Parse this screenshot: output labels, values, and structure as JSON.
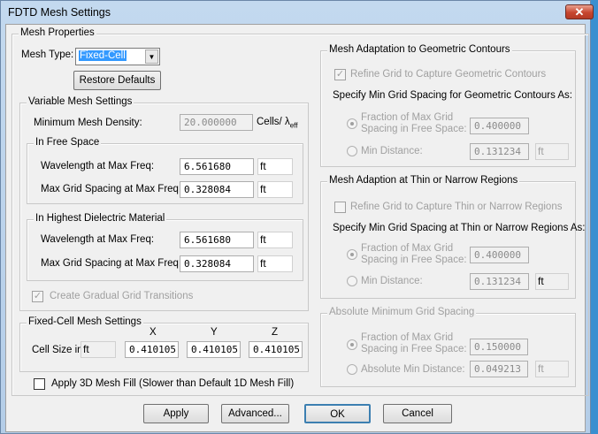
{
  "window": {
    "title": "FDTD Mesh Settings",
    "close_icon": "close-icon"
  },
  "mesh_properties": {
    "label": "Mesh Properties",
    "mesh_type_label": "Mesh Type:",
    "mesh_type_value": "Fixed-Cell",
    "restore_defaults": "Restore Defaults"
  },
  "variable_mesh": {
    "label": "Variable Mesh Settings",
    "min_density_label": "Minimum Mesh Density:",
    "min_density_value": "20.000000",
    "density_unit": "Cells/ λ",
    "density_unit_sub": "eff",
    "free_space": {
      "label": "In Free Space",
      "wavelength_label": "Wavelength at Max Freq:",
      "wavelength_value": "6.561680",
      "wavelength_unit": "ft",
      "spacing_label": "Max Grid Spacing at Max Freq:",
      "spacing_value": "0.328084",
      "spacing_unit": "ft"
    },
    "dielectric": {
      "label": "In Highest Dielectric Material",
      "wavelength_label": "Wavelength at Max Freq:",
      "wavelength_value": "6.561680",
      "wavelength_unit": "ft",
      "spacing_label": "Max Grid Spacing at Max Freq:",
      "spacing_value": "0.328084",
      "spacing_unit": "ft"
    },
    "gradual_label": "Create Gradual Grid Transitions",
    "gradual_checked": true
  },
  "fixed_cell": {
    "label": "Fixed-Cell Mesh Settings",
    "x_header": "X",
    "y_header": "Y",
    "z_header": "Z",
    "cell_size_label": "Cell Size in",
    "unit": "ft",
    "x": "0.410105",
    "y": "0.410105",
    "z": "0.410105"
  },
  "mesh_fill": {
    "label": "Apply 3D Mesh Fill (Slower than Default 1D Mesh Fill)",
    "checked": false
  },
  "geometric": {
    "label": "Mesh Adaptation to Geometric Contours",
    "refine_label": "Refine Grid to Capture Geometric Contours",
    "refine_checked": true,
    "specify_label": "Specify Min Grid Spacing for Geometric Contours As:",
    "fraction_label_1": "Fraction of Max Grid",
    "fraction_label_2": "Spacing in Free Space:",
    "fraction_value": "0.400000",
    "min_label": "Min Distance:",
    "min_value": "0.131234",
    "min_unit": "ft"
  },
  "thin": {
    "label": "Mesh Adaption at Thin or Narrow Regions",
    "refine_label": "Refine Grid to Capture Thin or Narrow Regions",
    "refine_checked": false,
    "specify_label": "Specify Min Grid Spacing at Thin or Narrow Regions As:",
    "fraction_label_1": "Fraction of Max Grid",
    "fraction_label_2": "Spacing in Free Space:",
    "fraction_value": "0.400000",
    "min_label": "Min Distance:",
    "min_value": "0.131234",
    "min_unit": "ft"
  },
  "absolute": {
    "label": "Absolute Minimum Grid Spacing",
    "fraction_label_1": "Fraction of Max Grid",
    "fraction_label_2": "Spacing in Free Space:",
    "fraction_value": "0.150000",
    "min_label": "Absolute Min Distance:",
    "min_value": "0.049213",
    "min_unit": "ft"
  },
  "buttons": {
    "apply": "Apply",
    "advanced": "Advanced...",
    "ok": "OK",
    "cancel": "Cancel"
  }
}
